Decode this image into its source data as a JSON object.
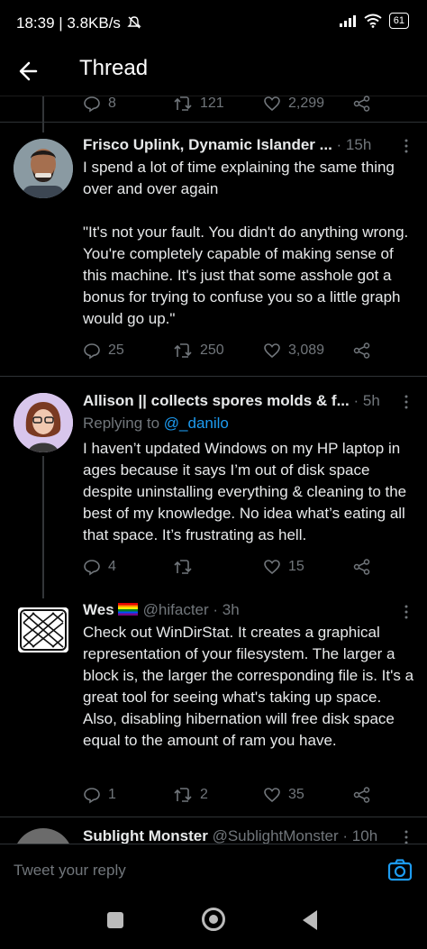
{
  "status_bar": {
    "time_speed": "18:39 | 3.8KB/s",
    "battery": "61"
  },
  "app_bar": {
    "title": "Thread"
  },
  "top_actions": {
    "replies": "8",
    "retweets": "121",
    "likes": "2,299"
  },
  "tweets": [
    {
      "name": "Frisco Uplink, Dynamic Islander ...",
      "time": "· 15h",
      "text": "I spend a lot of time explaining the same thing over and over again\n\n\"It's not your fault. You didn't do anything wrong. You're completely capable of making sense of this machine. It's just that some asshole got a bonus for trying to confuse you so a little graph would go up.\"",
      "replies": "25",
      "retweets": "250",
      "likes": "3,089"
    },
    {
      "name": "Allison || collects spores molds & f...",
      "time": "· 5h",
      "replying_label": "Replying to",
      "replying_handle": "@_danilo",
      "text": "I haven’t updated Windows on my HP laptop in ages because it says I’m out of disk space despite uninstalling everything & cleaning to the best of my knowledge. No idea what’s eating all that space. It’s frustrating as hell.",
      "replies": "4",
      "retweets": "",
      "likes": "15"
    },
    {
      "name": "Wes",
      "handle": "@hifacter",
      "time": "· 3h",
      "text": "Check out WinDirStat. It creates a graphical representation of your filesystem. The larger a block is, the larger the corresponding file is. It's a great tool for seeing what's taking up space. Also, disabling hibernation will free disk space equal to the amount of ram you have.",
      "replies": "1",
      "retweets": "2",
      "likes": "35"
    },
    {
      "name": "Sublight Monster",
      "handle": "@SublightMonster",
      "time": "· 10h"
    }
  ],
  "composer": {
    "placeholder": "Tweet your reply"
  }
}
